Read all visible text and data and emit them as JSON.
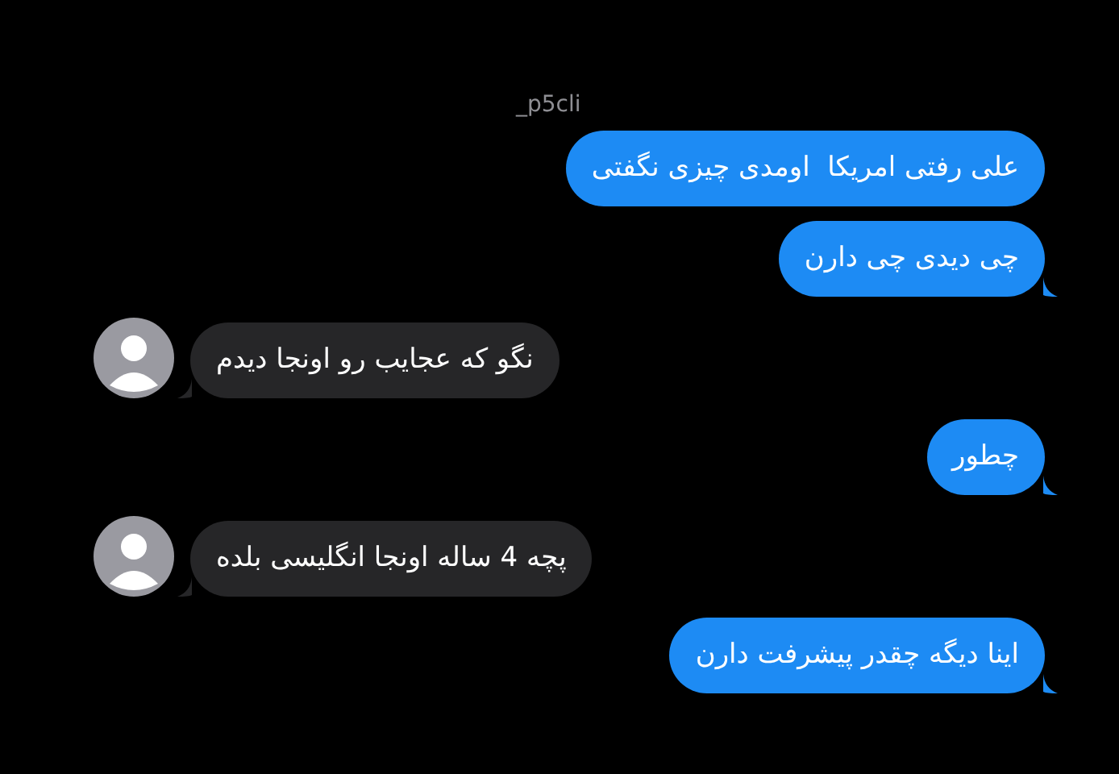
{
  "sender_name": "_p5cli",
  "messages": [
    {
      "kind": "sent",
      "text": "علی رفتی امریکا  اومدی چیزی نگفتی",
      "tail": false
    },
    {
      "kind": "sent",
      "text": "چی دیدی چی دارن",
      "tail": true
    },
    {
      "kind": "received",
      "text": "نگو که عجایب رو اونجا دیدم",
      "tail": true
    },
    {
      "kind": "sent",
      "text": "چطور",
      "tail": true
    },
    {
      "kind": "received",
      "text": "پچه 4 ساله اونجا انگلیسی بلده",
      "tail": true
    },
    {
      "kind": "sent",
      "text": "اینا دیگه چقدر پیشرفت دارن",
      "tail": true
    }
  ]
}
